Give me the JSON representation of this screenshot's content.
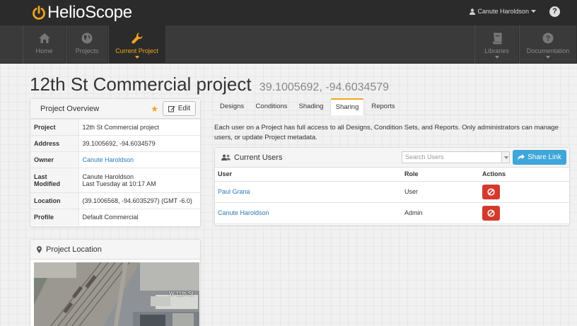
{
  "brand": "HelioScope",
  "user": {
    "name": "Canute Haroldson"
  },
  "nav": {
    "home": "Home",
    "projects": "Projects",
    "current_project": "Current Project",
    "libraries": "Libraries",
    "documentation": "Documentation"
  },
  "project": {
    "title": "12th St Commercial project",
    "coords": "39.1005692, -94.6034579"
  },
  "overview": {
    "heading": "Project Overview",
    "edit_label": "Edit",
    "rows": [
      {
        "key": "Project",
        "value": "12th St Commercial project"
      },
      {
        "key": "Address",
        "value": "39.1005692, -94.6034579"
      },
      {
        "key": "Owner",
        "value": "Canute Haroldson"
      },
      {
        "key": "Last Modified",
        "value": "Canute Haroldson",
        "value2": "Last Tuesday at 10:17 AM"
      },
      {
        "key": "Location",
        "value": "(39.1006568, -94.6035297) (GMT -6.0)"
      },
      {
        "key": "Profile",
        "value": "Default Commercial"
      }
    ]
  },
  "location_panel": {
    "heading": "Project Location",
    "street_label": "W 11th St"
  },
  "tabs": [
    "Designs",
    "Conditions",
    "Shading",
    "Sharing",
    "Reports"
  ],
  "active_tab": "Sharing",
  "sharing": {
    "description": "Each user on a Project has full access to all Designs, Condition Sets, and Reports. Only administrators can manage users, or update Project metadata.",
    "panel_heading": "Current Users",
    "search_placeholder": "Search Users",
    "share_link_label": "Share Link",
    "columns": [
      "User",
      "Role",
      "Actions"
    ],
    "users": [
      {
        "name": "Paul Grana",
        "role": "User"
      },
      {
        "name": "Canute Haroldson",
        "role": "Admin"
      }
    ]
  },
  "colors": {
    "accent": "#f0a51c",
    "link": "#2a7ab9",
    "danger": "#d33a2c",
    "info": "#3fa6d9",
    "topbar": "#2b2b2b",
    "navbar": "#3a3a3a"
  }
}
